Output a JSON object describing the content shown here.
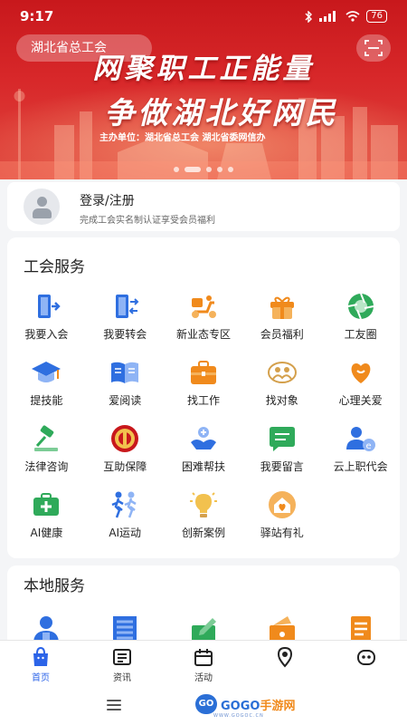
{
  "status_bar": {
    "time": "9:17",
    "battery": "76"
  },
  "banner": {
    "union_name": "湖北省总工会",
    "title_line1": "网聚职工正能量",
    "title_line2": "争做湖北好网民",
    "sponsor": "主办单位：湖北省总工会  湖北省委网信办",
    "slide_count": 5,
    "active_slide": 2
  },
  "login": {
    "title": "登录/注册",
    "subtitle": "完成工会实名制认证享受会员福利"
  },
  "union_services": {
    "title": "工会服务",
    "items": [
      {
        "label": "我要入会",
        "icon": "door-enter-icon"
      },
      {
        "label": "我要转会",
        "icon": "door-transfer-icon"
      },
      {
        "label": "新业态专区",
        "icon": "delivery-scooter-icon"
      },
      {
        "label": "会员福利",
        "icon": "gift-box-icon"
      },
      {
        "label": "工友圈",
        "icon": "camera-aperture-icon"
      },
      {
        "label": "提技能",
        "icon": "graduation-cap-icon"
      },
      {
        "label": "爱阅读",
        "icon": "open-book-icon"
      },
      {
        "label": "找工作",
        "icon": "briefcase-icon"
      },
      {
        "label": "找对象",
        "icon": "couple-emblem-icon"
      },
      {
        "label": "心理关爱",
        "icon": "heart-hands-icon"
      },
      {
        "label": "法律咨询",
        "icon": "gavel-icon"
      },
      {
        "label": "互助保障",
        "icon": "union-emblem-icon"
      },
      {
        "label": "困难帮扶",
        "icon": "helping-hand-icon"
      },
      {
        "label": "我要留言",
        "icon": "message-bubble-icon"
      },
      {
        "label": "云上职代会",
        "icon": "user-e-icon"
      },
      {
        "label": "AI健康",
        "icon": "medical-kit-icon"
      },
      {
        "label": "AI运动",
        "icon": "running-people-icon"
      },
      {
        "label": "创新案例",
        "icon": "lightbulb-icon"
      },
      {
        "label": "驿站有礼",
        "icon": "house-heart-icon"
      }
    ]
  },
  "local_services": {
    "title": "本地服务",
    "items": [
      {
        "icon": "user-badge-icon"
      },
      {
        "icon": "building-icon"
      },
      {
        "icon": "edit-document-icon"
      },
      {
        "icon": "ticket-icon"
      },
      {
        "icon": "list-document-icon"
      }
    ]
  },
  "tabbar": [
    {
      "label": "首页",
      "icon": "home-bag-icon",
      "active": true
    },
    {
      "label": "资讯",
      "icon": "news-icon",
      "active": false
    },
    {
      "label": "活动",
      "icon": "calendar-box-icon",
      "active": false
    },
    {
      "label": "",
      "icon": "location-pin-icon",
      "active": false
    },
    {
      "label": "",
      "icon": "robot-face-icon",
      "active": false
    }
  ],
  "watermark": {
    "logo": "GO",
    "text_a": "GOGO",
    "text_b": "手游网",
    "url": "WWW.GOGOC.CN"
  },
  "colors": {
    "brand_red": "#d4201f",
    "active_tab": "#2c64e8",
    "icon_blue": "#2f6fe0",
    "icon_orange": "#f08a1c",
    "icon_green": "#2faa5a"
  }
}
